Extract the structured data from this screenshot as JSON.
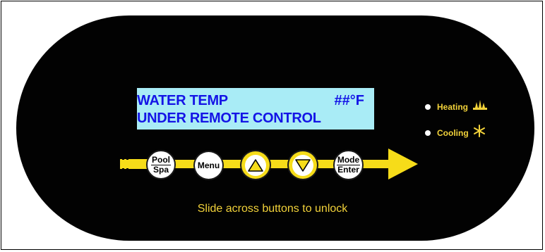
{
  "display": {
    "line1": "WATER TEMP",
    "temperature": "##°F",
    "line2": "UNDER REMOTE CONTROL"
  },
  "indicators": [
    {
      "label": "Heating",
      "icon": "heating-icon",
      "led_color": "#ffffff"
    },
    {
      "label": "Cooling",
      "icon": "cooling-snowflake-icon",
      "led_color": "#ffffff"
    }
  ],
  "buttons": {
    "pool_spa": {
      "top": "Pool",
      "bottom": "Spa"
    },
    "menu": {
      "label": "Menu"
    },
    "up": {
      "icon": "triangle-up-icon"
    },
    "down": {
      "icon": "triangle-down-icon"
    },
    "mode_enter": {
      "top": "Mode",
      "bottom": "Enter"
    }
  },
  "unlock_hint": "Slide across buttons to unlock",
  "colors": {
    "panel": "#020202",
    "lcd_background": "#a9ecf6",
    "lcd_text": "#1414e6",
    "accent_yellow": "#f6dc19",
    "label_yellow": "#f2d23a"
  }
}
